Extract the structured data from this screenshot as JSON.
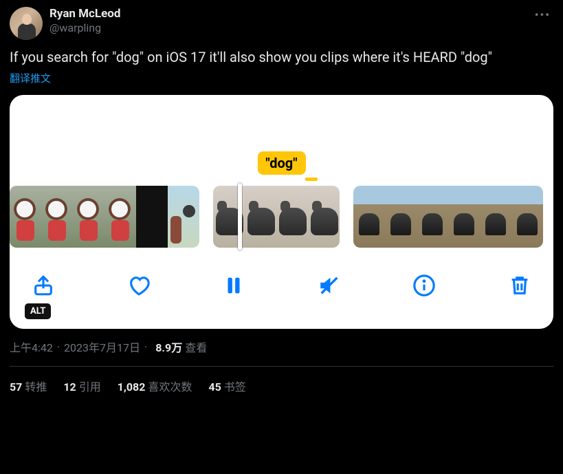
{
  "author": {
    "display_name": "Ryan McLeod",
    "handle": "@warpling"
  },
  "tweet_text": "If you search for \"dog\" on iOS 17 it'll also show you clips where it's HEARD \"dog\"",
  "translate_label": "翻译推文",
  "media": {
    "search_tag": "\"dog\"",
    "alt_badge": "ALT"
  },
  "meta": {
    "time": "上午4:42",
    "date": "2023年7月17日",
    "views_count": "8.9万",
    "views_label": "查看"
  },
  "stats": {
    "retweets": {
      "count": "57",
      "label": "转推"
    },
    "quotes": {
      "count": "12",
      "label": "引用"
    },
    "likes": {
      "count": "1,082",
      "label": "喜欢次数"
    },
    "bookmarks": {
      "count": "45",
      "label": "书签"
    }
  }
}
